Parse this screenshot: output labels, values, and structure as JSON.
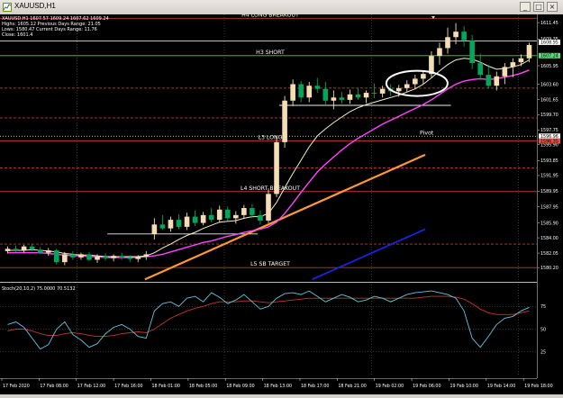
{
  "window": {
    "title": "XAUUSD,H1",
    "buttons": {
      "minimize": "_",
      "maximize": "□",
      "close": "×"
    }
  },
  "colors": {
    "background": "#000000",
    "bull_candle": "#f5deb3",
    "bear_candle": "#00a65a",
    "ma_fast": "#f5f0c8",
    "ma_slow": "#ff44ff",
    "ma_long": "#ff9933",
    "trend_blue": "#1a22dd",
    "pivot_red": "#c0392b",
    "pivot_green": "#33dd55",
    "stoch_main": "#63c5e0",
    "stoch_signal": "#c0392b",
    "highlight_ellipse": "#ffffff"
  },
  "chart_data": {
    "type": "candlestick",
    "symbol": "XAUUSD",
    "timeframe": "H1",
    "info": {
      "header": "XAUUSD,H1  1607.57 1609.24 1607.62 1609.24",
      "highs_line": "Highs: 1605.12  Previous Days Range: 21.05",
      "lows_line": "Lows: 1580.47  Current Days Range: 11.76",
      "close_line": "Close: 1601.4"
    },
    "ylim": [
      1578.5,
      1612.5
    ],
    "price_labels": [
      "1611.45",
      "1609.35",
      "1605.95",
      "1603.60",
      "1601.65",
      "1599.70",
      "1597.75",
      "1595.90",
      "1593.85",
      "1591.95",
      "1589.95",
      "1587.95",
      "1585.90",
      "1584.00",
      "1582.05",
      "1580.20",
      "1578.10"
    ],
    "price_values": [
      1611.45,
      1609.35,
      1605.95,
      1603.6,
      1601.65,
      1599.7,
      1597.75,
      1595.9,
      1593.85,
      1591.95,
      1589.95,
      1587.95,
      1585.9,
      1584.0,
      1582.05,
      1580.2,
      1578.1
    ],
    "badges": [
      {
        "text": "1608.95",
        "value": 1608.95,
        "color": "#ffffff"
      },
      {
        "text": "1607.24",
        "value": 1607.24,
        "color": "#5ddc7a"
      },
      {
        "text": "1596.96",
        "value": 1596.96,
        "color": "#ffffff"
      },
      {
        "text": "1596.35",
        "value": 1596.35,
        "color": "#e05040"
      }
    ],
    "levels": [
      {
        "label": "H4 LONG BREAKOUT",
        "value": 1612.0,
        "color": "#c0392b",
        "style": "solid"
      },
      {
        "label": "",
        "value": 1609.1,
        "color": "#dddddd",
        "style": "solid"
      },
      {
        "label": "H3 SHORT",
        "value": 1607.24,
        "color": "#33dd55",
        "style": "solid"
      },
      {
        "label": "",
        "value": 1603.1,
        "color": "#c0392b",
        "style": "dashed"
      },
      {
        "label": "",
        "value": 1600.9,
        "color": "#eeeeee",
        "style": "solid",
        "from": 0.52,
        "to": 0.84
      },
      {
        "label": "",
        "value": 1599.3,
        "color": "#c0392b",
        "style": "dashed"
      },
      {
        "label": "Pivot",
        "value": 1596.96,
        "color": "#cccccc",
        "style": "dotted"
      },
      {
        "label": "L3 LONG",
        "value": 1596.35,
        "color": "#c0392b",
        "style": "solid"
      },
      {
        "label": "",
        "value": 1592.9,
        "color": "#c0392b",
        "style": "dashed"
      },
      {
        "label": "L4 SHORT BREAKOUT",
        "value": 1589.9,
        "color": "#c0392b",
        "style": "solid"
      },
      {
        "label": "",
        "value": 1584.5,
        "color": "#eeeeee",
        "style": "solid",
        "from": 0.2,
        "to": 0.48
      },
      {
        "label": "",
        "value": 1583.2,
        "color": "#c0392b",
        "style": "dashed"
      },
      {
        "label": "L5 SB TARGET",
        "value": 1580.2,
        "color": "#c0392b",
        "style": "solid"
      }
    ],
    "candles": [
      [
        1582.3,
        1582.9,
        1582.0,
        1582.6
      ],
      [
        1582.6,
        1583.0,
        1582.2,
        1582.4
      ],
      [
        1582.4,
        1583.1,
        1582.1,
        1582.9
      ],
      [
        1582.9,
        1583.2,
        1582.3,
        1582.5
      ],
      [
        1582.5,
        1582.8,
        1581.9,
        1582.1
      ],
      [
        1582.1,
        1582.7,
        1581.7,
        1582.4
      ],
      [
        1582.4,
        1582.6,
        1580.6,
        1580.9
      ],
      [
        1580.9,
        1582.2,
        1580.5,
        1581.9
      ],
      [
        1581.9,
        1582.3,
        1581.2,
        1581.5
      ],
      [
        1581.5,
        1582.1,
        1581.2,
        1581.9
      ],
      [
        1581.9,
        1582.2,
        1581.0,
        1581.2
      ],
      [
        1581.2,
        1581.9,
        1580.8,
        1581.6
      ],
      [
        1581.6,
        1582.0,
        1581.1,
        1581.4
      ],
      [
        1581.4,
        1581.9,
        1581.0,
        1581.7
      ],
      [
        1581.7,
        1582.1,
        1581.2,
        1581.5
      ],
      [
        1581.5,
        1581.8,
        1580.9,
        1581.3
      ],
      [
        1581.3,
        1581.8,
        1580.9,
        1581.6
      ],
      [
        1581.6,
        1582.3,
        1581.2,
        1581.9
      ],
      [
        1584.5,
        1586.5,
        1583.8,
        1585.7
      ],
      [
        1585.7,
        1586.9,
        1585.0,
        1585.2
      ],
      [
        1585.2,
        1586.7,
        1584.8,
        1586.3
      ],
      [
        1586.3,
        1587.0,
        1585.1,
        1585.4
      ],
      [
        1585.4,
        1587.2,
        1585.0,
        1586.7
      ],
      [
        1586.7,
        1587.5,
        1585.5,
        1585.9
      ],
      [
        1585.9,
        1587.3,
        1585.6,
        1586.9
      ],
      [
        1586.9,
        1587.8,
        1586.0,
        1586.3
      ],
      [
        1586.3,
        1588.1,
        1585.9,
        1587.6
      ],
      [
        1587.6,
        1588.0,
        1586.2,
        1586.5
      ],
      [
        1586.5,
        1587.4,
        1585.8,
        1586.9
      ],
      [
        1586.9,
        1588.2,
        1586.4,
        1587.8
      ],
      [
        1587.8,
        1588.3,
        1586.5,
        1586.9
      ],
      [
        1586.9,
        1587.5,
        1585.7,
        1586.2
      ],
      [
        1586.2,
        1590.3,
        1585.9,
        1589.6
      ],
      [
        1589.6,
        1596.8,
        1589.2,
        1596.2
      ],
      [
        1596.2,
        1602.1,
        1595.5,
        1601.5
      ],
      [
        1601.5,
        1604.2,
        1600.8,
        1603.6
      ],
      [
        1603.6,
        1604.0,
        1601.3,
        1601.9
      ],
      [
        1601.9,
        1603.9,
        1601.3,
        1603.4
      ],
      [
        1603.4,
        1604.4,
        1602.5,
        1603.0
      ],
      [
        1603.0,
        1603.9,
        1600.9,
        1601.5
      ],
      [
        1601.5,
        1602.8,
        1600.4,
        1601.9
      ],
      [
        1601.9,
        1602.6,
        1601.1,
        1601.6
      ],
      [
        1601.6,
        1602.9,
        1601.1,
        1602.3
      ],
      [
        1602.3,
        1603.1,
        1601.6,
        1601.9
      ],
      [
        1601.9,
        1602.8,
        1601.2,
        1602.5
      ],
      [
        1602.5,
        1603.7,
        1601.8,
        1602.4
      ],
      [
        1602.4,
        1603.4,
        1601.9,
        1603.0
      ],
      [
        1603.0,
        1603.6,
        1602.1,
        1602.7
      ],
      [
        1602.7,
        1603.5,
        1602.0,
        1603.1
      ],
      [
        1603.1,
        1604.1,
        1602.6,
        1603.6
      ],
      [
        1603.6,
        1604.8,
        1603.0,
        1604.3
      ],
      [
        1604.3,
        1605.2,
        1603.6,
        1604.9
      ],
      [
        1604.9,
        1607.8,
        1604.5,
        1607.2
      ],
      [
        1607.2,
        1608.9,
        1606.1,
        1608.2
      ],
      [
        1608.2,
        1610.8,
        1607.5,
        1609.6
      ],
      [
        1609.6,
        1611.4,
        1608.7,
        1610.3
      ],
      [
        1610.3,
        1611.0,
        1608.4,
        1609.2
      ],
      [
        1609.2,
        1609.9,
        1605.5,
        1606.3
      ],
      [
        1606.3,
        1607.5,
        1604.1,
        1604.8
      ],
      [
        1604.8,
        1606.1,
        1603.0,
        1603.4
      ],
      [
        1603.4,
        1605.2,
        1602.8,
        1604.6
      ],
      [
        1604.6,
        1606.3,
        1603.6,
        1605.8
      ],
      [
        1605.8,
        1606.9,
        1604.5,
        1606.4
      ],
      [
        1606.4,
        1607.4,
        1605.9,
        1606.9
      ],
      [
        1606.9,
        1608.9,
        1606.4,
        1608.6
      ]
    ],
    "ma_fast": [
      1582.4,
      1582.4,
      1582.4,
      1582.5,
      1582.4,
      1582.3,
      1582.2,
      1582.0,
      1581.9,
      1581.8,
      1581.8,
      1581.7,
      1581.6,
      1581.6,
      1581.6,
      1581.6,
      1581.6,
      1581.7,
      1582.1,
      1582.7,
      1583.2,
      1583.8,
      1584.3,
      1584.7,
      1585.2,
      1585.6,
      1586.0,
      1586.1,
      1586.2,
      1586.5,
      1586.7,
      1586.7,
      1587.1,
      1588.5,
      1590.4,
      1592.2,
      1593.9,
      1595.6,
      1597.0,
      1597.9,
      1598.7,
      1599.4,
      1600.1,
      1600.6,
      1601.0,
      1601.3,
      1601.6,
      1601.9,
      1602.2,
      1602.6,
      1603.0,
      1603.6,
      1604.4,
      1605.3,
      1606.1,
      1606.7,
      1606.9,
      1606.8,
      1606.4,
      1605.9,
      1605.5,
      1605.6,
      1605.8,
      1606.1,
      1606.7
    ],
    "ma_slow": [
      1582.1,
      1582.1,
      1582.1,
      1582.1,
      1582.1,
      1582.0,
      1581.9,
      1581.8,
      1581.7,
      1581.7,
      1581.6,
      1581.6,
      1581.5,
      1581.5,
      1581.5,
      1581.5,
      1581.5,
      1581.6,
      1581.7,
      1581.9,
      1582.2,
      1582.5,
      1582.8,
      1583.1,
      1583.4,
      1583.6,
      1583.9,
      1584.2,
      1584.4,
      1584.7,
      1584.9,
      1585.1,
      1585.4,
      1586.0,
      1587.1,
      1588.4,
      1589.8,
      1591.1,
      1592.4,
      1593.4,
      1594.3,
      1595.2,
      1596.0,
      1596.7,
      1597.3,
      1597.9,
      1598.5,
      1599.0,
      1599.5,
      1600.0,
      1600.5,
      1601.0,
      1601.6,
      1602.3,
      1603.0,
      1603.6,
      1604.0,
      1604.2,
      1604.3,
      1604.2,
      1604.3,
      1604.5,
      1604.7,
      1605.0,
      1605.4
    ],
    "ma_long": {
      "x_from": 0.27,
      "x_to": 1.0,
      "y_from": 1578.7,
      "y_to": 1594.6
    },
    "trend_blue": {
      "x_from": 0.59,
      "x_to": 1.0,
      "y_from": 1578.7,
      "y_to": 1585.1
    },
    "highlight_ellipse": {
      "x": 0.926,
      "y": 1603.7
    },
    "x_labels": [
      "17 Feb 2020",
      "17 Feb 08:00",
      "17 Feb 12:00",
      "17 Feb 16:00",
      "18 Feb 01:00",
      "18 Feb 05:00",
      "18 Feb 09:00",
      "18 Feb 13:00",
      "18 Feb 17:00",
      "18 Feb 21:00",
      "19 Feb 02:00",
      "19 Feb 06:00",
      "19 Feb 10:00",
      "19 Feb 14:00",
      "19 Feb 18:00"
    ],
    "stochastic": {
      "title": "Stoch(20,10,2) 75.0000 70.5132",
      "levels": [
        75,
        50,
        25
      ],
      "ylim": [
        0,
        100
      ],
      "main": [
        55,
        58,
        52,
        40,
        28,
        33,
        50,
        58,
        44,
        38,
        30,
        34,
        45,
        52,
        55,
        50,
        42,
        40,
        70,
        78,
        80,
        75,
        84,
        86,
        80,
        90,
        85,
        78,
        82,
        88,
        80,
        72,
        75,
        84,
        89,
        90,
        88,
        92,
        86,
        80,
        84,
        88,
        85,
        80,
        82,
        86,
        84,
        80,
        84,
        88,
        90,
        91,
        92,
        90,
        88,
        84,
        70,
        40,
        30,
        42,
        55,
        62,
        64,
        70,
        74
      ],
      "signal": [
        48,
        50,
        50,
        48,
        45,
        43,
        43,
        45,
        46,
        45,
        43,
        42,
        42,
        43,
        45,
        46,
        47,
        46,
        50,
        56,
        62,
        66,
        70,
        73,
        75,
        78,
        80,
        80,
        80,
        81,
        81,
        80,
        79,
        80,
        81,
        82,
        83,
        84,
        84,
        84,
        84,
        84,
        84,
        84,
        84,
        84,
        84,
        84,
        84,
        84,
        84,
        85,
        86,
        86,
        86,
        85,
        83,
        78,
        72,
        68,
        66,
        66,
        66,
        68,
        70
      ]
    }
  }
}
